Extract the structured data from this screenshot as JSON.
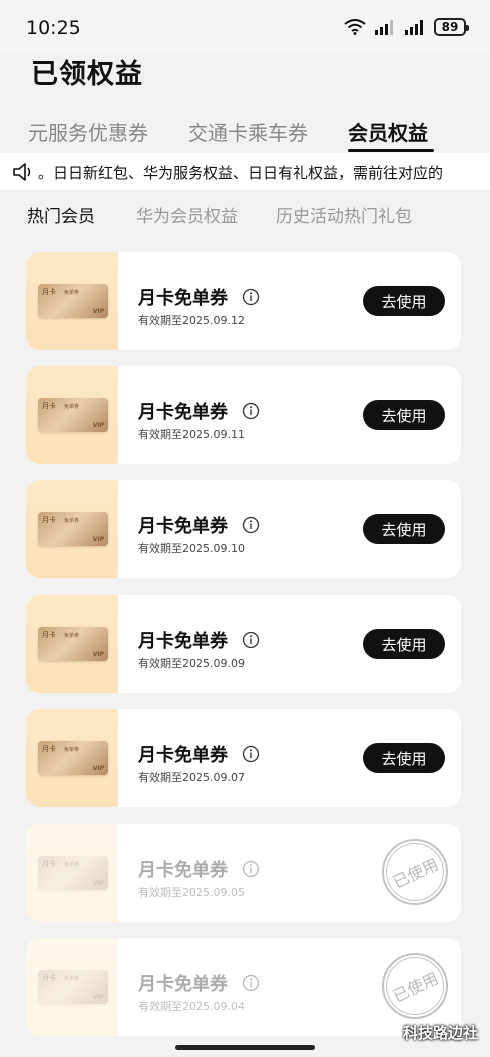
{
  "status_bar": {
    "time": "10:25",
    "battery": "89",
    "icons": [
      "wifi-icon",
      "signal-icon",
      "signal-icon",
      "battery-icon"
    ]
  },
  "page_title": "已领权益",
  "tabs": [
    {
      "label": "元服务优惠券",
      "active": false
    },
    {
      "label": "交通卡乘车券",
      "active": false
    },
    {
      "label": "会员权益",
      "active": true
    }
  ],
  "notice": {
    "icon": "speaker-icon",
    "text": "。日日新红包、华为服务权益、日日有礼权益，需前往对应的"
  },
  "subtabs": [
    {
      "label": "热门会员",
      "active": true
    },
    {
      "label": "华为会员权益",
      "active": false
    },
    {
      "label": "历史活动热门礼包",
      "active": false
    }
  ],
  "vip_card_art": {
    "label": "月卡",
    "small": "免单券",
    "vip": "VIP"
  },
  "coupons": [
    {
      "name": "月卡免单券",
      "validity": "有效期至2025.09.12",
      "action": "去使用",
      "used": false
    },
    {
      "name": "月卡免单券",
      "validity": "有效期至2025.09.11",
      "action": "去使用",
      "used": false
    },
    {
      "name": "月卡免单券",
      "validity": "有效期至2025.09.10",
      "action": "去使用",
      "used": false
    },
    {
      "name": "月卡免单券",
      "validity": "有效期至2025.09.09",
      "action": "去使用",
      "used": false
    },
    {
      "name": "月卡免单券",
      "validity": "有效期至2025.09.07",
      "action": "去使用",
      "used": false
    },
    {
      "name": "月卡免单券",
      "validity": "有效期至2025.09.05",
      "stamp": "已使用",
      "used": true
    },
    {
      "name": "月卡免单券",
      "validity": "有效期至2025.09.04",
      "stamp": "已使用",
      "used": true
    }
  ],
  "watermark": "科技路边社",
  "colors": {
    "background": "#f2f2f2",
    "button": "#111111",
    "thumb": "#fde9c8"
  }
}
